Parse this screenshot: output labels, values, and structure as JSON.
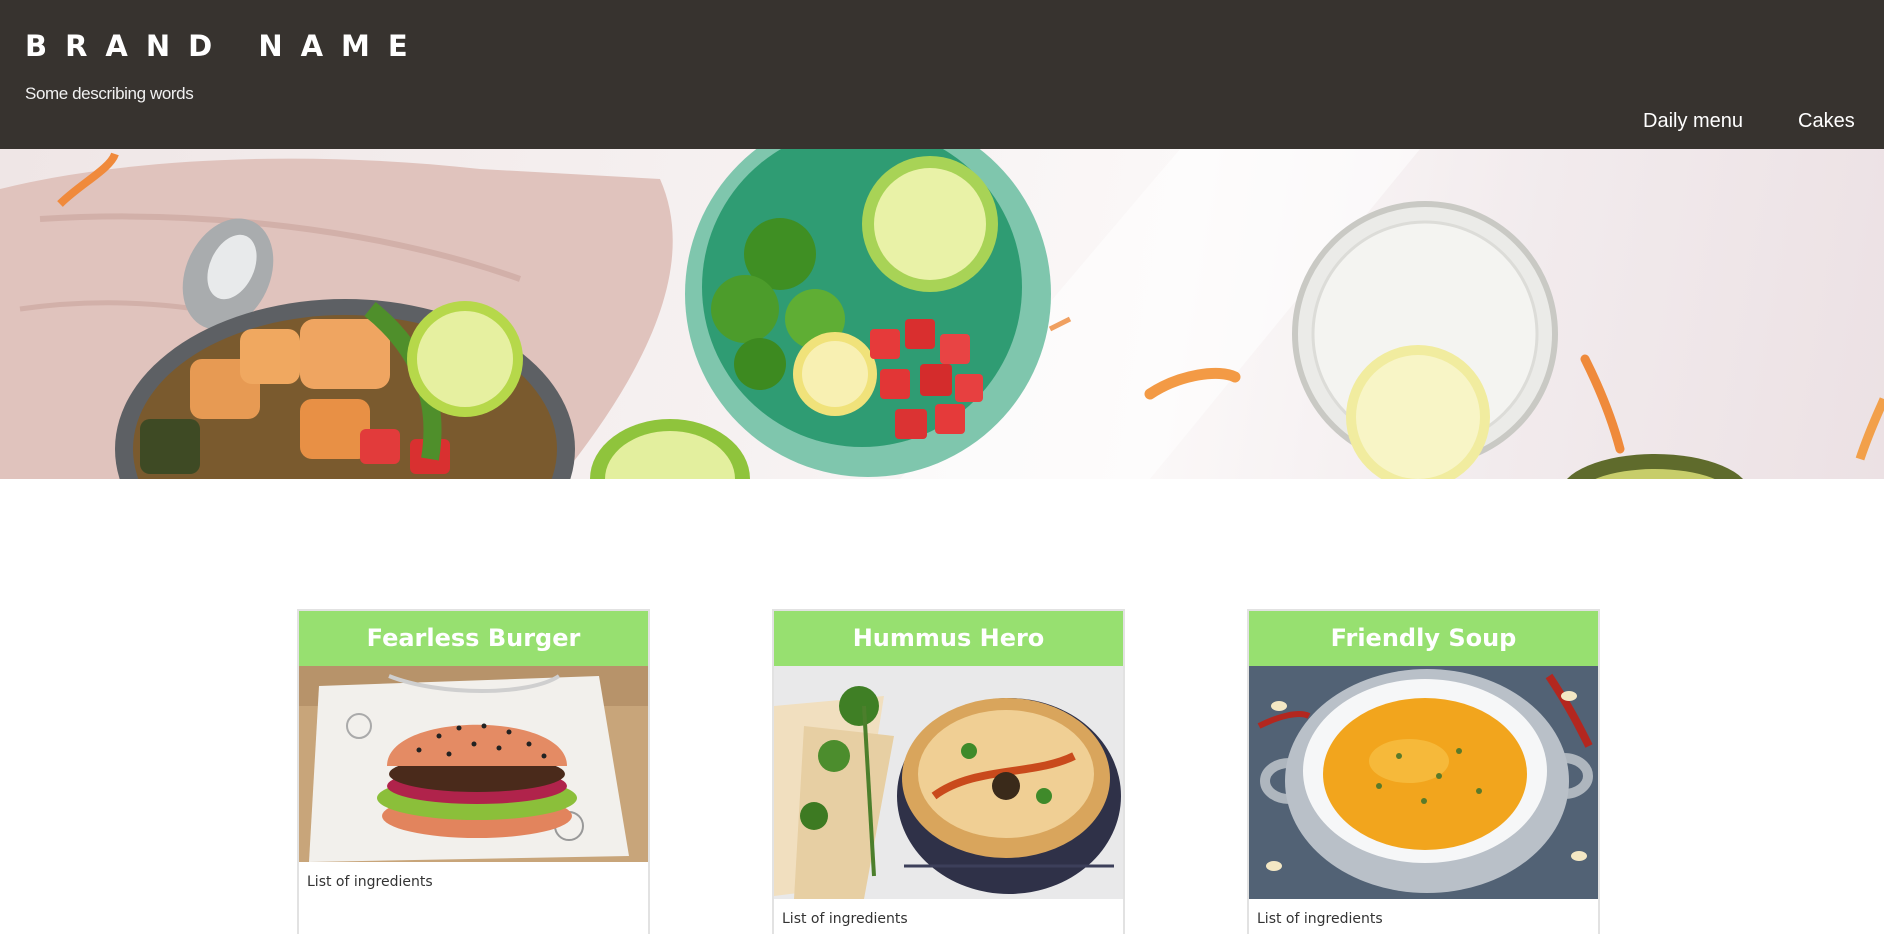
{
  "header": {
    "brand": "BRAND NAME",
    "tagline": "Some describing words",
    "background": "#37332f"
  },
  "nav": {
    "items": [
      {
        "label": "Daily menu"
      },
      {
        "label": "Cakes"
      }
    ]
  },
  "hero": {
    "image": "food-flatlay-banner"
  },
  "cards": [
    {
      "title": "Fearless Burger",
      "ingredients": "List of ingredients",
      "image": "burger-photo"
    },
    {
      "title": "Hummus Hero",
      "ingredients": "List of ingredients",
      "image": "hummus-photo"
    },
    {
      "title": "Friendly Soup",
      "ingredients": "List of ingredients",
      "image": "soup-photo"
    }
  ],
  "colors": {
    "card_title_bg": "#97e070",
    "card_title_text": "#ffffff",
    "card_border": "#e2e2e2"
  }
}
